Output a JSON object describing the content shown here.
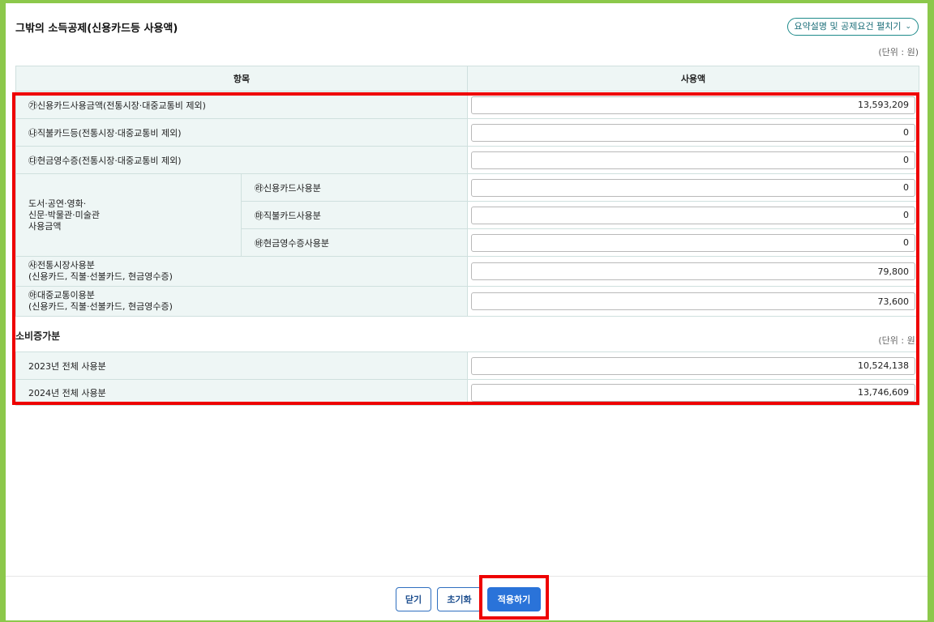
{
  "header": {
    "title": "그밖의 소득공제(신용카드등 사용액)",
    "expand_label": "요약설명 및 공제요건 펼치기",
    "unit_label": "(단위 : 원)"
  },
  "table": {
    "col_item": "항목",
    "col_amount": "사용액",
    "rows": [
      {
        "label": "㉮신용카드사용금액(전통시장·대중교통비 제외)",
        "value": "13,593,209"
      },
      {
        "label": "㉯직불카드등(전통시장·대중교통비 제외)",
        "value": "0"
      },
      {
        "label": "㉰현금영수증(전통시장·대중교통비 제외)",
        "value": "0"
      }
    ],
    "group": {
      "label_lines": [
        "도서·공연·영화·",
        "신문·박물관·미술관",
        "사용금액"
      ],
      "subrows": [
        {
          "label": "㉱신용카드사용분",
          "value": "0"
        },
        {
          "label": "㉲직불카드사용분",
          "value": "0"
        },
        {
          "label": "㉳현금영수증사용분",
          "value": "0"
        }
      ]
    },
    "rows2": [
      {
        "line1": "㉴전통시장사용분",
        "line2": "(신용카드, 직불·선불카드, 현금영수증)",
        "value": "79,800"
      },
      {
        "line1": "㉵대중교통이용분",
        "line2": "(신용카드, 직불·선불카드, 현금영수증)",
        "value": "73,600"
      }
    ]
  },
  "increase": {
    "title": "소비증가분",
    "unit_label": "(단위 : 원)",
    "rows": [
      {
        "label": "2023년 전체 사용분",
        "value": "10,524,138"
      },
      {
        "label": "2024년 전체 사용분",
        "value": "13,746,609"
      }
    ]
  },
  "footer": {
    "close_label": "닫기",
    "reset_label": "초기화",
    "apply_label": "적용하기"
  },
  "colors": {
    "background": "#8cc84b",
    "highlight": "#ee0000",
    "primary_button": "#2a73d9"
  }
}
